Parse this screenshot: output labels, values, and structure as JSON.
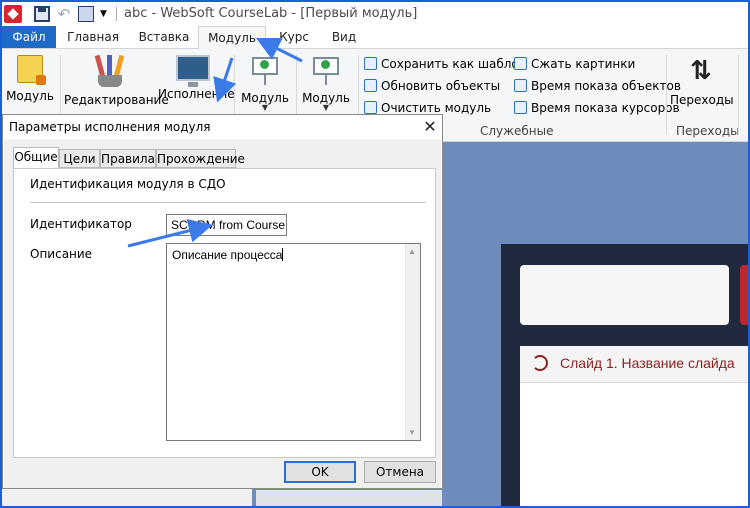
{
  "window": {
    "title": "abc - WebSoft CourseLab - [Первый модуль]"
  },
  "tabs": [
    {
      "label": "Файл"
    },
    {
      "label": "Главная"
    },
    {
      "label": "Вставка"
    },
    {
      "label": "Модуль"
    },
    {
      "label": "Курс"
    },
    {
      "label": "Вид"
    }
  ],
  "ribbon": {
    "module_btn": "Модуль",
    "edit_btn": "Редактирование",
    "exec_btn": "Исполнение",
    "module_btn2": "Модуль",
    "module_btn3": "Модуль",
    "service": [
      {
        "label": "Сохранить как шаблон"
      },
      {
        "label": "Обновить объекты"
      },
      {
        "label": "Очистить модуль"
      },
      {
        "label": "Сжать картинки"
      },
      {
        "label": "Время показа объектов"
      },
      {
        "label": "Время показа курсоров"
      }
    ],
    "service_group": "Служебные",
    "transitions_btn": "Переходы",
    "transitions_group": "Переходы"
  },
  "slide": {
    "title": "Слайд 1. Название слайда"
  },
  "dialog": {
    "title": "Параметры исполнения модуля",
    "close": "✕",
    "tabs": [
      {
        "label": "Общие"
      },
      {
        "label": "Цели"
      },
      {
        "label": "Правила"
      },
      {
        "label": "Прохождение"
      }
    ],
    "section_title": "Идентификация модуля в СДО",
    "identifier_label": "Идентификатор",
    "identifier_value": "SCORM from CourseLab",
    "description_label": "Описание",
    "description_value": "Описание процесса",
    "ok": "OK",
    "cancel": "Отмена"
  },
  "colors": {
    "accent": "#1d6bc6",
    "annotation_arrow": "#3a7be8",
    "slide_title": "#8b1f1f"
  }
}
